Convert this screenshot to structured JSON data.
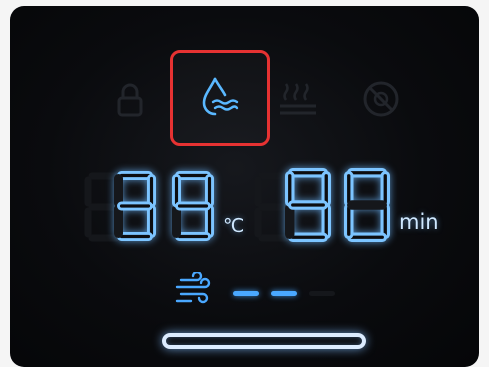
{
  "panel": {
    "background_color": "#0a0b0e",
    "accent_color": "#4aa8ff",
    "highlight_color": "#e63232"
  },
  "status_icons": [
    {
      "name": "lock-icon",
      "lit": false
    },
    {
      "name": "water-drop-wave-icon",
      "lit": true,
      "highlighted": true
    },
    {
      "name": "steam-wave-icon",
      "lit": false
    },
    {
      "name": "no-symbol-icon",
      "lit": false
    }
  ],
  "temperature": {
    "value": "39",
    "unit": "℃"
  },
  "timer": {
    "value": "90",
    "unit": "min"
  },
  "fan": {
    "icon": "wind-icon",
    "level": 2,
    "max_level": 4
  },
  "progress_bar": {
    "icon": "lit-bar"
  }
}
